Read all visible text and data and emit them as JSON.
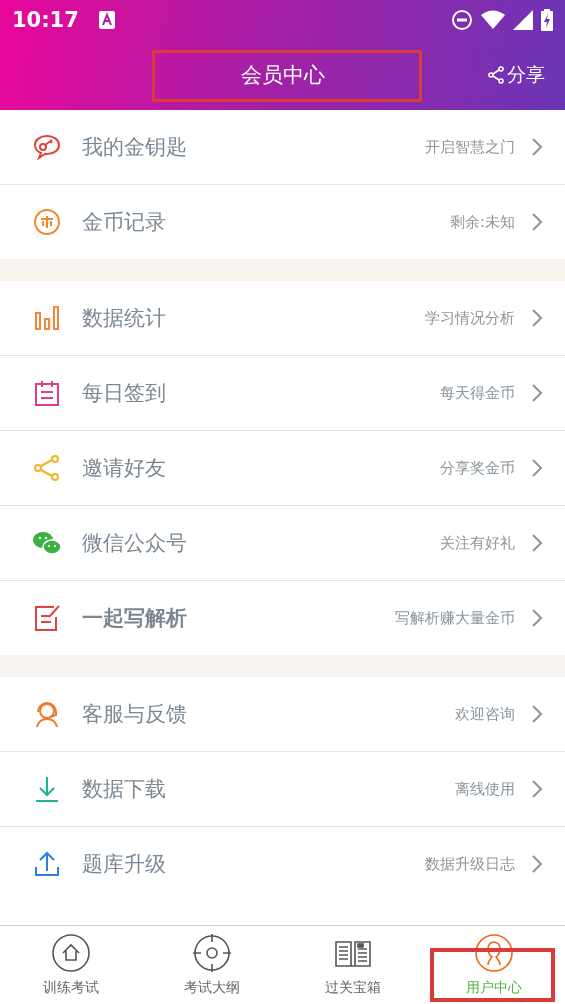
{
  "status_bar": {
    "time": "10:17"
  },
  "header": {
    "title": "会员中心",
    "title_highlighted": true,
    "share_label": "分享"
  },
  "groups": [
    {
      "items": [
        {
          "kind": "key",
          "label": "我的金钥匙",
          "hint": "开启智慧之门",
          "emphasized": false
        },
        {
          "kind": "coin",
          "label": "金币记录",
          "hint": "剩余:未知",
          "emphasized": false
        }
      ]
    },
    {
      "items": [
        {
          "kind": "stats",
          "label": "数据统计",
          "hint": "学习情况分析",
          "emphasized": false
        },
        {
          "kind": "calendar",
          "label": "每日签到",
          "hint": "每天得金币",
          "emphasized": false
        },
        {
          "kind": "share",
          "label": "邀请好友",
          "hint": "分享奖金币",
          "emphasized": false
        },
        {
          "kind": "wechat",
          "label": "微信公众号",
          "hint": "关注有好礼",
          "emphasized": false
        },
        {
          "kind": "edit",
          "label": "一起写解析",
          "hint": "写解析赚大量金币",
          "emphasized": true
        }
      ]
    },
    {
      "items": [
        {
          "kind": "support",
          "label": "客服与反馈",
          "hint": "欢迎咨询",
          "emphasized": false
        },
        {
          "kind": "download",
          "label": "数据下载",
          "hint": "离线使用",
          "emphasized": false
        },
        {
          "kind": "upload",
          "label": "题库升级",
          "hint": "数据升级日志",
          "emphasized": false
        }
      ]
    }
  ],
  "tabs": [
    {
      "kind": "home",
      "label": "训练考试",
      "selected": false,
      "highlighted": false
    },
    {
      "kind": "target",
      "label": "考试大纲",
      "selected": false,
      "highlighted": false
    },
    {
      "kind": "book",
      "label": "过关宝箱",
      "selected": false,
      "highlighted": false
    },
    {
      "kind": "user",
      "label": "用户中心",
      "selected": true,
      "highlighted": true
    }
  ]
}
